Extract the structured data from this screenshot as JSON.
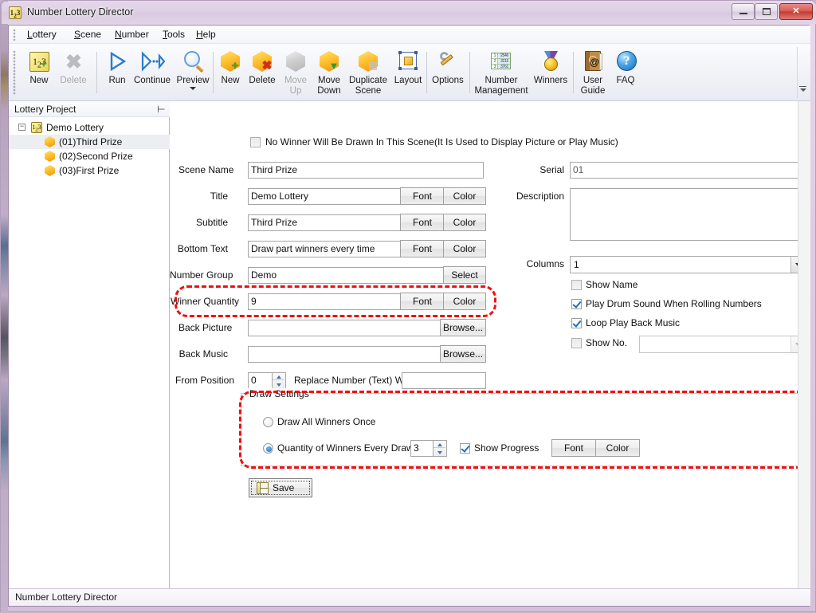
{
  "window": {
    "title": "Number Lottery Director",
    "icon": "app-icon",
    "controls": {
      "minimize": "minimize",
      "maximize": "maximize",
      "close": "✕"
    }
  },
  "menubar": {
    "items": [
      {
        "label": "Lottery",
        "accel": "L"
      },
      {
        "label": "Scene",
        "accel": "S"
      },
      {
        "label": "Number",
        "accel": "N"
      },
      {
        "label": "Tools",
        "accel": "T"
      },
      {
        "label": "Help",
        "accel": "H"
      }
    ]
  },
  "toolbar": {
    "items": [
      {
        "label": "New",
        "icon": "new-number-icon",
        "disabled": false
      },
      {
        "label": "Delete",
        "icon": "delete-x-icon",
        "disabled": true
      },
      {
        "label": "Run",
        "icon": "run-play-icon",
        "disabled": false
      },
      {
        "label": "Continue",
        "icon": "continue-icon",
        "disabled": false
      },
      {
        "label": "Preview",
        "icon": "magnifier-icon",
        "disabled": false
      },
      {
        "label": "New",
        "icon": "cube-plus-icon",
        "disabled": false
      },
      {
        "label": "Delete",
        "icon": "cube-x-icon",
        "disabled": false
      },
      {
        "label": "Move\nUp",
        "icon": "cube-up-icon",
        "disabled": true
      },
      {
        "label": "Move\nDown",
        "icon": "cube-down-icon",
        "disabled": false
      },
      {
        "label": "Duplicate\nScene",
        "icon": "cube-copy-icon",
        "disabled": false
      },
      {
        "label": "Layout",
        "icon": "layout-icon",
        "disabled": false
      },
      {
        "label": "Options",
        "icon": "wrench-icon",
        "disabled": false
      },
      {
        "label": "Number\nManagement",
        "icon": "number-grid-icon",
        "disabled": false
      },
      {
        "label": "Winners",
        "icon": "medal-icon",
        "disabled": false
      },
      {
        "label": "User\nGuide",
        "icon": "book-icon",
        "disabled": false
      },
      {
        "label": "FAQ",
        "icon": "question-icon",
        "disabled": false
      }
    ]
  },
  "tree": {
    "header": "Lottery Project",
    "pin": "pin-icon",
    "root": {
      "label": "Demo Lottery",
      "expander": "−",
      "icon": "lottery-icon"
    },
    "children": [
      {
        "label": "(01)Third Prize",
        "selected": true
      },
      {
        "label": "(02)Second Prize",
        "selected": false
      },
      {
        "label": "(03)First Prize",
        "selected": false
      }
    ]
  },
  "form": {
    "no_winner": {
      "label": "No Winner Will Be Drawn In This Scene",
      "hint": "(It Is Used to Display Picture or Play Music)",
      "checked": false
    },
    "scene_name": {
      "label": "Scene Name",
      "value": "Third Prize"
    },
    "title": {
      "label": "Title",
      "value": "Demo Lottery",
      "font": "Font",
      "color": "Color"
    },
    "subtitle": {
      "label": "Subtitle",
      "value": "Third Prize",
      "font": "Font",
      "color": "Color"
    },
    "bottom_text": {
      "label": "Bottom Text",
      "value": "Draw part winners every time",
      "font": "Font",
      "color": "Color"
    },
    "number_group": {
      "label": "Number Group",
      "value": "Demo",
      "select": "Select"
    },
    "winner_quantity": {
      "label": "Winner Quantity",
      "value": "9",
      "font": "Font",
      "color": "Color"
    },
    "back_picture": {
      "label": "Back Picture",
      "value": "",
      "browse": "Browse..."
    },
    "back_music": {
      "label": "Back Music",
      "value": "",
      "browse": "Browse..."
    },
    "from_position": {
      "label": "From Position",
      "value": "0"
    },
    "replace_number": {
      "label": "Replace Number (Text) With",
      "value": ""
    },
    "serial": {
      "label": "Serial",
      "value": "01"
    },
    "description": {
      "label": "Description",
      "value": ""
    },
    "columns": {
      "label": "Columns",
      "value": "1"
    },
    "show_name": {
      "label": "Show Name",
      "checked": false
    },
    "play_drum": {
      "label": "Play Drum Sound When Rolling Numbers",
      "checked": true
    },
    "loop_music": {
      "label": "Loop Play Back Music",
      "checked": true
    },
    "show_no": {
      "label": "Show No.",
      "checked": false,
      "combo_value": ""
    },
    "draw_settings": {
      "title": "Draw Settings",
      "option_all": {
        "label": "Draw All Winners Once",
        "selected": false
      },
      "option_every": {
        "label": "Quantity of Winners Every Draw",
        "selected": true,
        "value": "3"
      },
      "show_progress": {
        "label": "Show Progress",
        "checked": true
      },
      "font": "Font",
      "color": "Color"
    },
    "save": {
      "label": "Save",
      "icon": "save-disk-icon"
    }
  },
  "statusbar": {
    "text": "Number Lottery Director"
  },
  "colors": {
    "annotation": "#f01010",
    "titlebar_start": "#e5d6ea",
    "titlebar_end": "#e2d4e8",
    "close_button": "#c23c33",
    "accent_blue": "#1f6fbd",
    "cube_gold": "#ffc533"
  },
  "annotations": [
    {
      "name": "winner-quantity-highlight"
    },
    {
      "name": "draw-settings-highlight"
    }
  ]
}
